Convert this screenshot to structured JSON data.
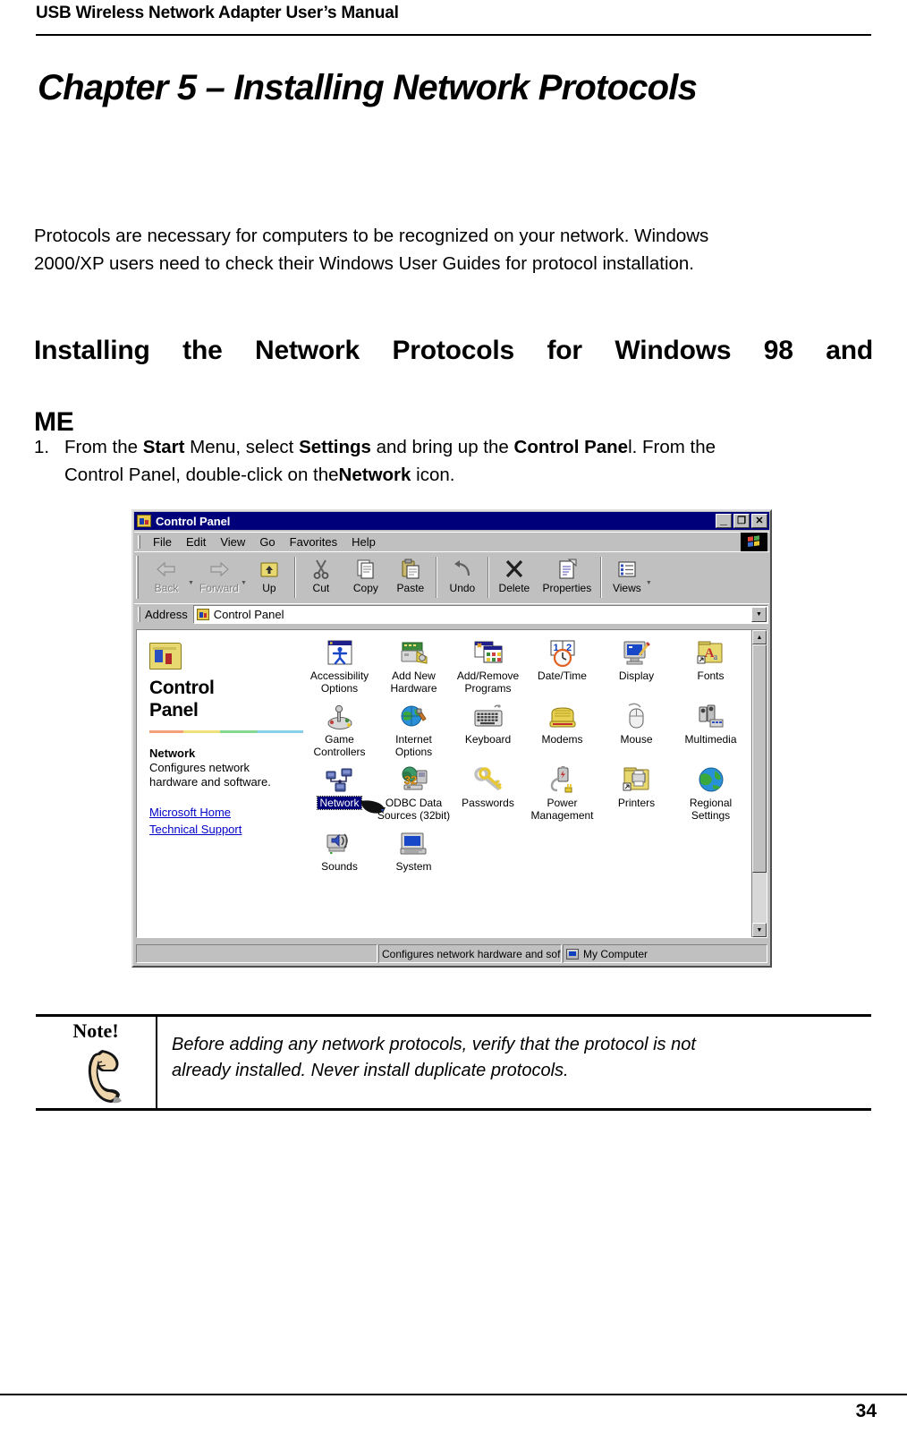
{
  "document": {
    "header_title": "USB Wireless Network Adapter User’s Manual",
    "chapter_title": "Chapter 5 – Installing Network Protocols",
    "intro_line1": "Protocols are necessary for computers to be recognized on your network. Windows",
    "intro_line2": "2000/XP users need to check their Windows User Guides for protocol installation.",
    "section_heading_line1": "Installing the Network Protocols for Windows 98 and",
    "section_heading_line2": "ME",
    "page_number": "34"
  },
  "step": {
    "number": "1.",
    "l1_a": "From the ",
    "l1_start": "Start",
    "l1_b": " Menu, select ",
    "l1_settings": "Settings",
    "l1_c": " and bring up the ",
    "l1_cpanel": "Control Pane",
    "l1_d": "l. From the",
    "l2_a": "Control Panel, double-click on the",
    "l2_network": "Network",
    "l2_b": " icon."
  },
  "control_panel": {
    "title": "Control Panel",
    "window_buttons": [
      {
        "name": "minimize",
        "glyph": "_"
      },
      {
        "name": "restore",
        "glyph": "❐"
      },
      {
        "name": "close",
        "glyph": "✕"
      }
    ],
    "menus": [
      "File",
      "Edit",
      "View",
      "Go",
      "Favorites",
      "Help"
    ],
    "toolbar": [
      {
        "label": "Back",
        "icon": "back-arrow-icon",
        "disabled": true,
        "dropdown": true
      },
      {
        "label": "Forward",
        "icon": "forward-arrow-icon",
        "disabled": true,
        "dropdown": true
      },
      {
        "label": "Up",
        "icon": "up-folder-icon",
        "disabled": false,
        "dropdown": false
      },
      {
        "label": "Cut",
        "icon": "scissors-icon",
        "disabled": false,
        "dropdown": false
      },
      {
        "label": "Copy",
        "icon": "copy-icon",
        "disabled": false,
        "dropdown": false
      },
      {
        "label": "Paste",
        "icon": "paste-icon",
        "disabled": false,
        "dropdown": false
      },
      {
        "label": "Undo",
        "icon": "undo-arrow-icon",
        "disabled": false,
        "dropdown": false
      },
      {
        "label": "Delete",
        "icon": "delete-x-icon",
        "disabled": false,
        "dropdown": false
      },
      {
        "label": "Properties",
        "icon": "properties-icon",
        "disabled": false,
        "dropdown": false
      },
      {
        "label": "Views",
        "icon": "views-list-icon",
        "disabled": false,
        "dropdown": true
      }
    ],
    "address": {
      "label": "Address",
      "value": "Control Panel"
    },
    "sidebar": {
      "title_line1": "Control",
      "title_line2": "Panel",
      "selected_name": "Network",
      "selected_desc_line1": "Configures network",
      "selected_desc_line2": "hardware and software.",
      "links": [
        "Microsoft Home",
        "Technical Support"
      ]
    },
    "items": [
      {
        "label": "Accessibility\nOptions",
        "icon": "accessibility-icon",
        "selected": false
      },
      {
        "label": "Add New\nHardware",
        "icon": "add-new-hardware-icon",
        "selected": false
      },
      {
        "label": "Add/Remove\nPrograms",
        "icon": "add-remove-programs-icon",
        "selected": false
      },
      {
        "label": "Date/Time",
        "icon": "date-time-icon",
        "selected": false
      },
      {
        "label": "Display",
        "icon": "display-icon",
        "selected": false
      },
      {
        "label": "Fonts",
        "icon": "fonts-icon",
        "selected": false
      },
      {
        "label": "Game\nControllers",
        "icon": "game-controllers-icon",
        "selected": false
      },
      {
        "label": "Internet\nOptions",
        "icon": "internet-options-icon",
        "selected": false
      },
      {
        "label": "Keyboard",
        "icon": "keyboard-icon",
        "selected": false
      },
      {
        "label": "Modems",
        "icon": "modems-icon",
        "selected": false
      },
      {
        "label": "Mouse",
        "icon": "mouse-icon",
        "selected": false
      },
      {
        "label": "Multimedia",
        "icon": "multimedia-icon",
        "selected": false
      },
      {
        "label": "Network",
        "icon": "network-icon",
        "selected": true
      },
      {
        "label": "ODBC Data\nSources (32bit)",
        "icon": "odbc-data-sources-icon",
        "selected": false
      },
      {
        "label": "Passwords",
        "icon": "passwords-icon",
        "selected": false
      },
      {
        "label": "Power\nManagement",
        "icon": "power-management-icon",
        "selected": false
      },
      {
        "label": "Printers",
        "icon": "printers-icon",
        "selected": false
      },
      {
        "label": "Regional\nSettings",
        "icon": "regional-settings-icon",
        "selected": false
      },
      {
        "label": "Sounds",
        "icon": "sounds-icon",
        "selected": false
      },
      {
        "label": "System",
        "icon": "system-icon",
        "selected": false
      }
    ],
    "status": {
      "pane1": "",
      "pane2": "Configures network hardware and sof",
      "pane3": "My Computer"
    }
  },
  "note": {
    "label": "Note!",
    "text_line1": "Before adding any network protocols, verify that the protocol is not",
    "text_line2": "already installed. Never install duplicate protocols."
  },
  "colors": {
    "titlebar": "#00007b",
    "window_face": "#c0c0c0",
    "selection": "#00007b",
    "link": "#0000c8"
  }
}
